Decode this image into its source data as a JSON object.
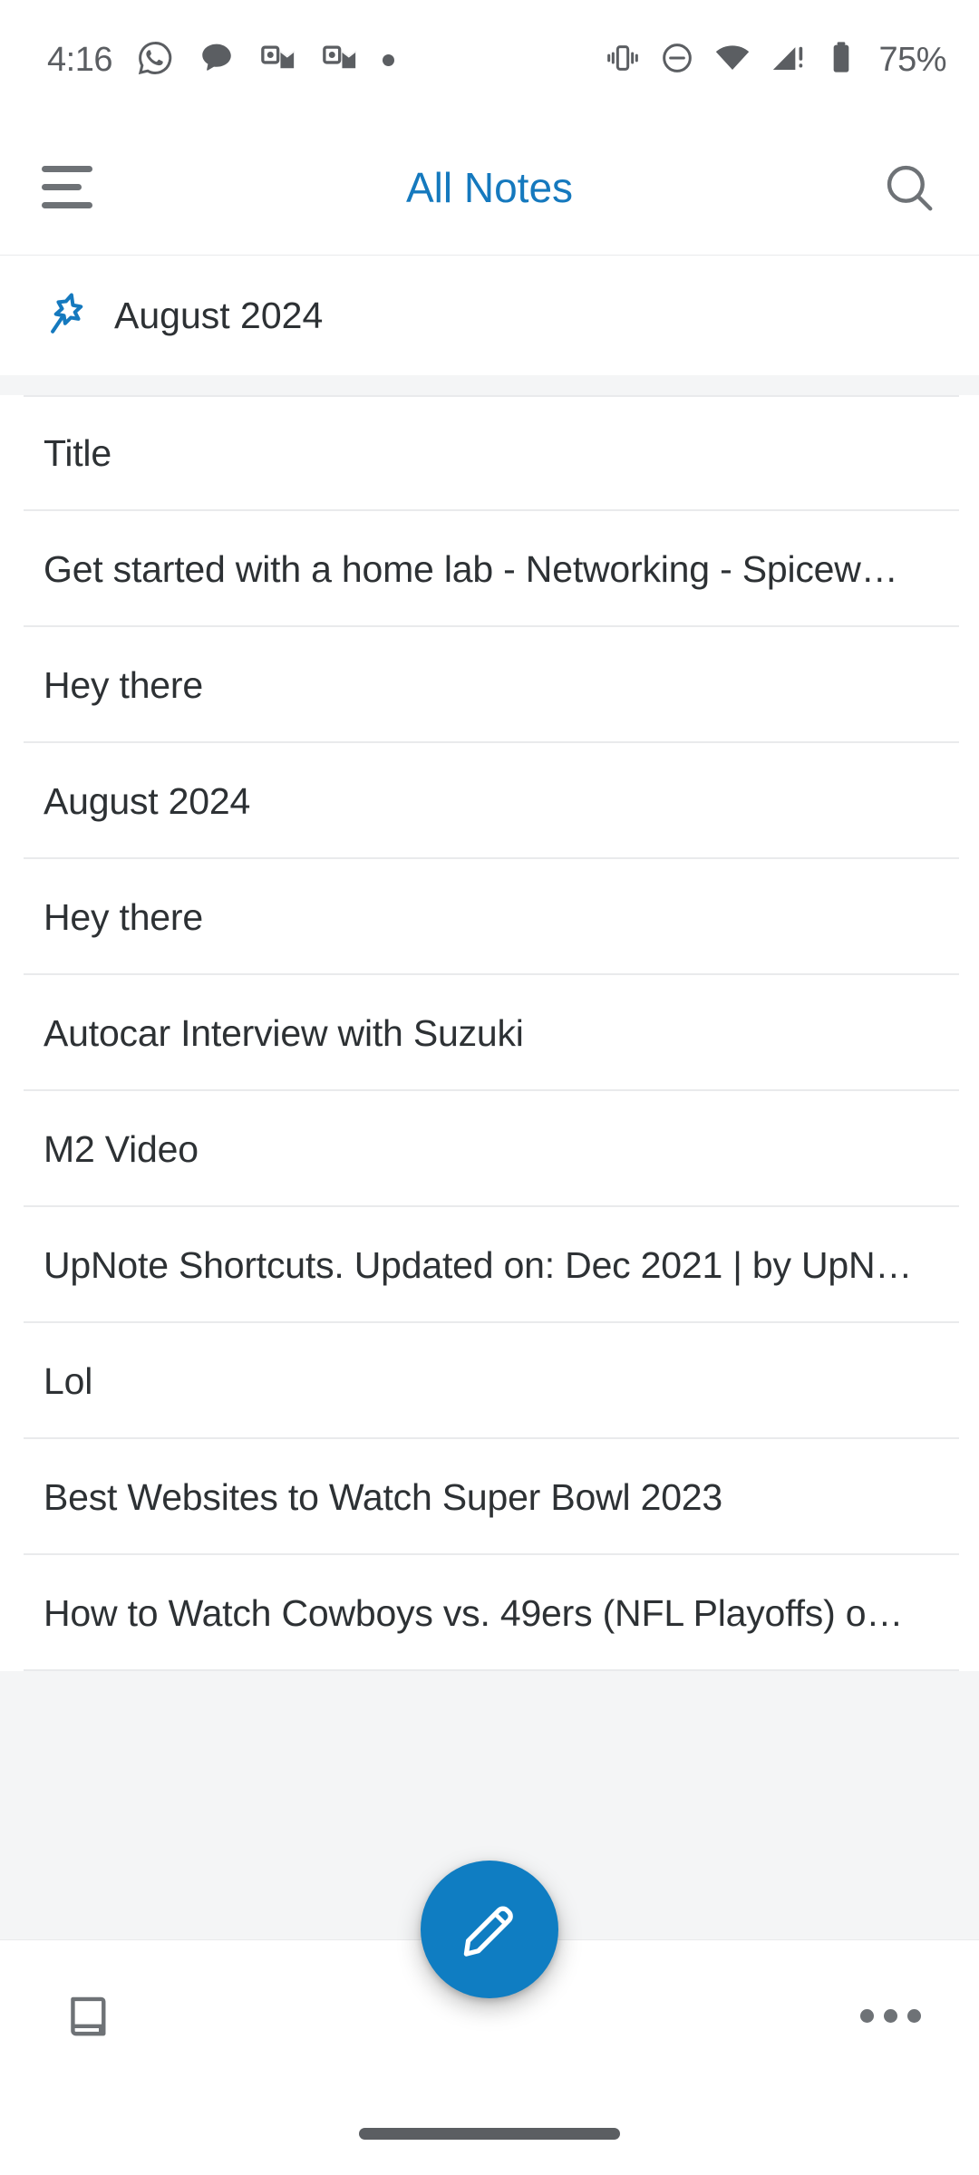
{
  "status_bar": {
    "time": "4:16",
    "left_icons": [
      {
        "name": "whatsapp-icon"
      },
      {
        "name": "chat-bubble-icon"
      },
      {
        "name": "outlook-icon"
      },
      {
        "name": "outlook-icon"
      },
      {
        "name": "notification-dot-icon"
      }
    ],
    "right_icons": [
      {
        "name": "vibrate-icon"
      },
      {
        "name": "do-not-disturb-icon"
      },
      {
        "name": "wifi-icon"
      },
      {
        "name": "cellular-signal-alert-icon"
      },
      {
        "name": "battery-icon"
      }
    ],
    "battery_percent": "75%",
    "icon_color": "#5b5e62"
  },
  "app_bar": {
    "menu_label": "menu",
    "title": "All Notes",
    "title_color": "#1579be",
    "search_label": "search"
  },
  "pinned": {
    "icon": "pin-icon",
    "icon_color": "#1579be",
    "label": "August 2024"
  },
  "notes": [
    {
      "title": "Title"
    },
    {
      "title": "Get started with a home lab - Networking - Spicew…"
    },
    {
      "title": "Hey there"
    },
    {
      "title": "August 2024"
    },
    {
      "title": "Hey there"
    },
    {
      "title": "Autocar Interview with Suzuki"
    },
    {
      "title": "M2 Video"
    },
    {
      "title": "UpNote Shortcuts. Updated on: Dec 2021 | by UpN…"
    },
    {
      "title": "Lol"
    },
    {
      "title": "Best Websites to Watch Super Bowl 2023"
    },
    {
      "title": "How to Watch Cowboys vs. 49ers (NFL Playoffs) o…"
    }
  ],
  "bottom_bar": {
    "notebooks_label": "Notebooks",
    "compose_label": "New note",
    "more_label": "More",
    "fab_color": "#0f7dc2"
  },
  "colors": {
    "accent": "#1579be",
    "fab": "#0f7dc2",
    "text": "#2d3134",
    "icon_gray": "#6e7276",
    "divider": "#e9eaec",
    "backdrop": "#f4f5f6"
  }
}
